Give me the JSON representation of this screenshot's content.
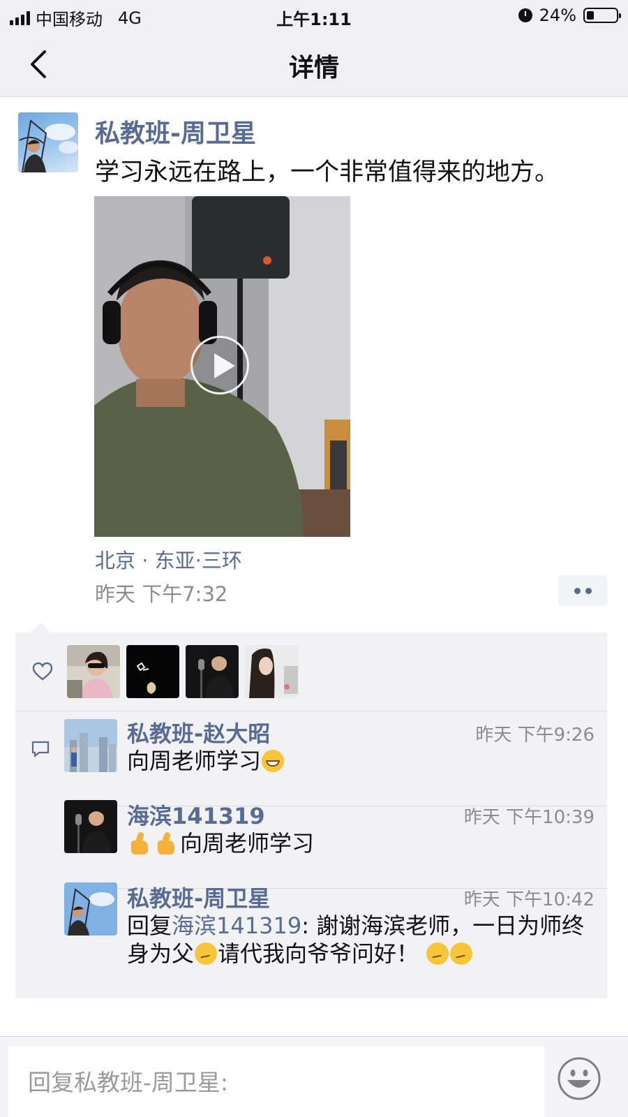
{
  "status_bar": {
    "carrier": "中国移动",
    "network": "4G",
    "time": "上午1:11",
    "battery_text": "24%",
    "battery_level": 0.24
  },
  "nav": {
    "title": "详情",
    "back_icon": "chevron-left-icon"
  },
  "post": {
    "author": "私教班-周卫星",
    "text": "学习永远在路上，一个非常值得来的地方。",
    "location": "北京 · 东亚·三环",
    "time": "昨天 下午7:32",
    "media_type": "video",
    "play_icon": "play-icon",
    "more_icon": "more-dots-icon"
  },
  "likes": {
    "icon": "heart-icon",
    "count": 4
  },
  "comments": {
    "icon": "comment-icon",
    "items": [
      {
        "name": "私教班-赵大昭",
        "time": "昨天 下午9:26",
        "text": "向周老师学习"
      },
      {
        "name": "海滨141319",
        "time": "昨天 下午10:39",
        "text": "向周老师学习"
      },
      {
        "name": "私教班-周卫星",
        "time": "昨天 下午10:42",
        "reply_prefix": "回复",
        "reply_to": "海滨141319",
        "text_part1": ": 謝谢海滨老师，一日为师终身为父",
        "text_part2": "请代我向爷爷问好！"
      }
    ]
  },
  "reply_bar": {
    "placeholder": "回复私教班-周卫星:",
    "emoji_icon": "smiley-icon"
  },
  "colors": {
    "link_blue": "#576b95",
    "meta_gray": "#8c8c8c",
    "bar_bg": "#efeff4",
    "panel_bg": "#f2f2f5"
  }
}
